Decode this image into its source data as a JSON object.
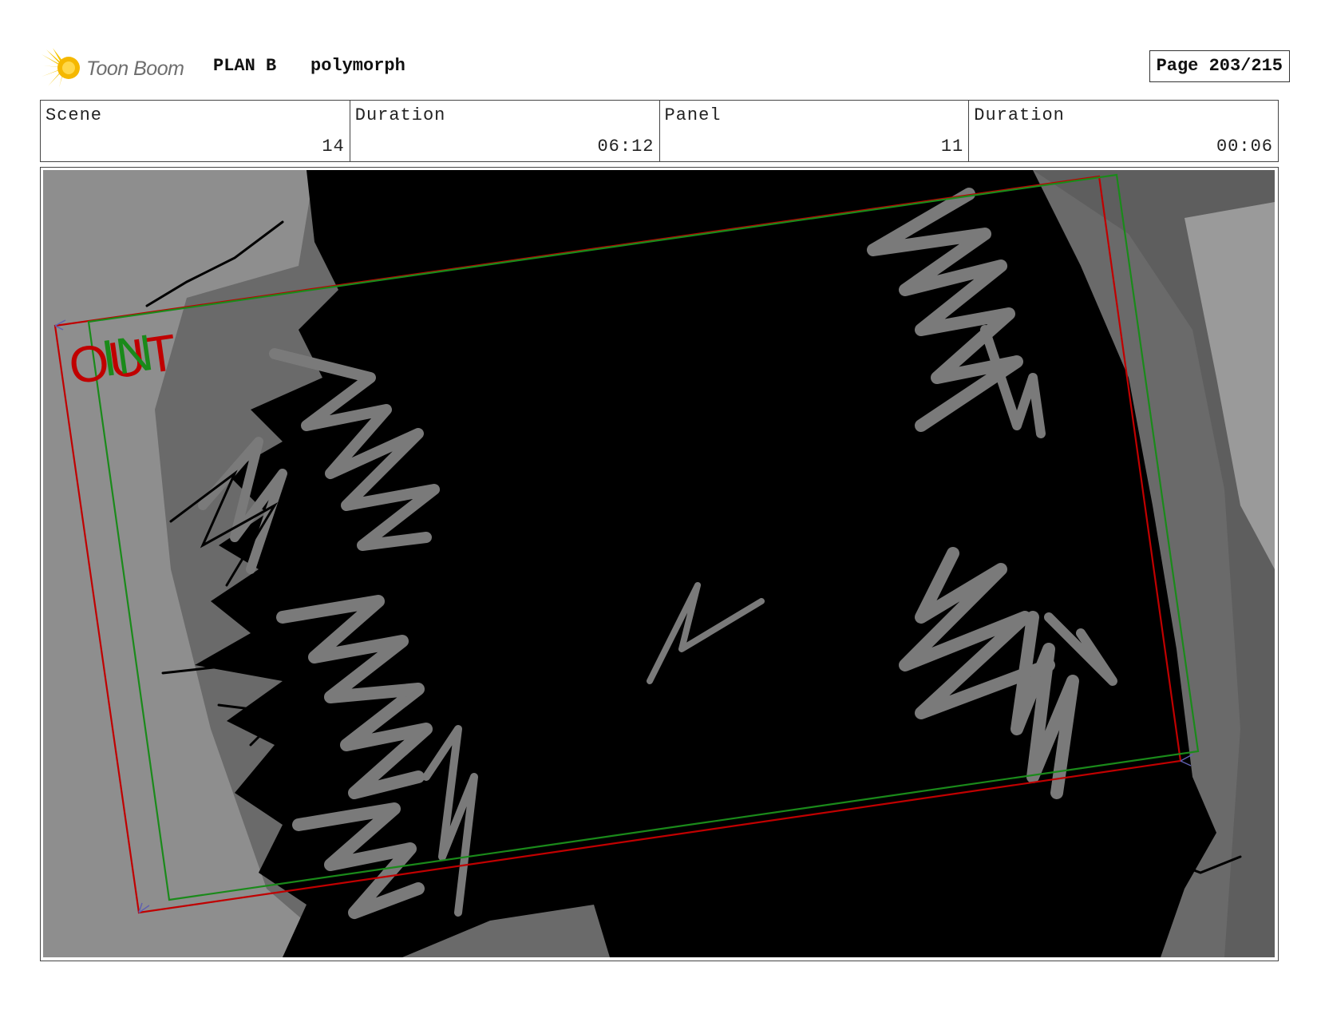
{
  "header": {
    "logo_text": "Toon Boom",
    "project": "PLAN B",
    "episode": "polymorph",
    "page": "Page 203/215"
  },
  "info": {
    "scene_label": "Scene",
    "scene_value": "14",
    "scene_duration_label": "Duration",
    "scene_duration_value": "06:12",
    "panel_label": "Panel",
    "panel_value": "11",
    "panel_duration_label": "Duration",
    "panel_duration_value": "00:06"
  },
  "panel": {
    "camera_out_label": "OUT",
    "camera_in_label": "IN",
    "colors": {
      "out_frame": "#c00000",
      "in_frame": "#1a8a1a"
    }
  }
}
